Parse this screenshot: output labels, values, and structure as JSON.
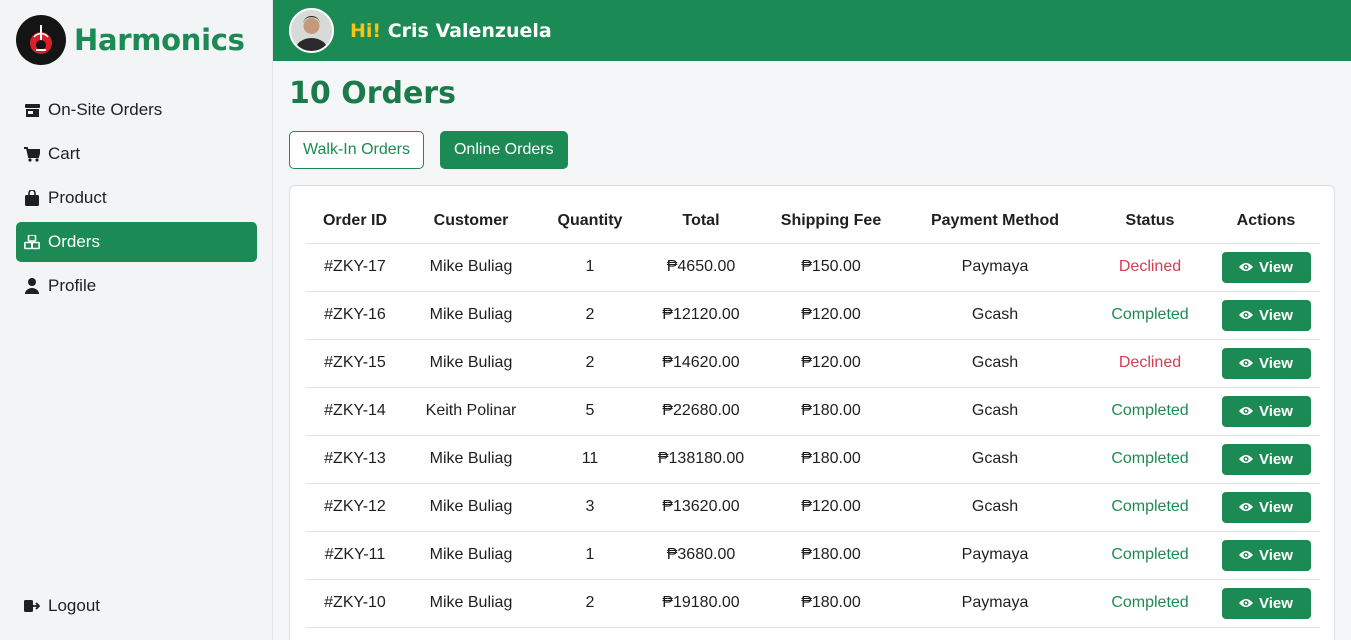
{
  "brand": {
    "name": "Harmonics"
  },
  "sidebar": {
    "items": [
      {
        "label": "On-Site Orders",
        "icon": "store-icon"
      },
      {
        "label": "Cart",
        "icon": "cart-icon"
      },
      {
        "label": "Product",
        "icon": "bag-icon"
      },
      {
        "label": "Orders",
        "icon": "boxes-icon",
        "active": true
      },
      {
        "label": "Profile",
        "icon": "user-icon"
      }
    ],
    "logout_label": "Logout"
  },
  "header": {
    "greeting": "Hi!",
    "user_name": "Cris Valenzuela"
  },
  "main": {
    "title": "10 Orders",
    "tabs": [
      {
        "label": "Walk-In Orders"
      },
      {
        "label": "Online Orders"
      }
    ]
  },
  "table": {
    "headers": [
      "Order ID",
      "Customer",
      "Quantity",
      "Total",
      "Shipping Fee",
      "Payment Method",
      "Status",
      "Actions"
    ],
    "view_label": "View",
    "rows": [
      {
        "id": "#ZKY-17",
        "customer": "Mike Buliag",
        "qty": "1",
        "total": "₱4650.00",
        "ship": "₱150.00",
        "method": "Paymaya",
        "status": "Declined"
      },
      {
        "id": "#ZKY-16",
        "customer": "Mike Buliag",
        "qty": "2",
        "total": "₱12120.00",
        "ship": "₱120.00",
        "method": "Gcash",
        "status": "Completed"
      },
      {
        "id": "#ZKY-15",
        "customer": "Mike Buliag",
        "qty": "2",
        "total": "₱14620.00",
        "ship": "₱120.00",
        "method": "Gcash",
        "status": "Declined"
      },
      {
        "id": "#ZKY-14",
        "customer": "Keith Polinar",
        "qty": "5",
        "total": "₱22680.00",
        "ship": "₱180.00",
        "method": "Gcash",
        "status": "Completed"
      },
      {
        "id": "#ZKY-13",
        "customer": "Mike Buliag",
        "qty": "11",
        "total": "₱138180.00",
        "ship": "₱180.00",
        "method": "Gcash",
        "status": "Completed"
      },
      {
        "id": "#ZKY-12",
        "customer": "Mike Buliag",
        "qty": "3",
        "total": "₱13620.00",
        "ship": "₱120.00",
        "method": "Gcash",
        "status": "Completed"
      },
      {
        "id": "#ZKY-11",
        "customer": "Mike Buliag",
        "qty": "1",
        "total": "₱3680.00",
        "ship": "₱180.00",
        "method": "Paymaya",
        "status": "Completed"
      },
      {
        "id": "#ZKY-10",
        "customer": "Mike Buliag",
        "qty": "2",
        "total": "₱19180.00",
        "ship": "₱180.00",
        "method": "Paymaya",
        "status": "Completed"
      }
    ]
  },
  "colors": {
    "accent": "#1b8a54",
    "declined": "#d0404e",
    "greeting": "#f5c518"
  }
}
